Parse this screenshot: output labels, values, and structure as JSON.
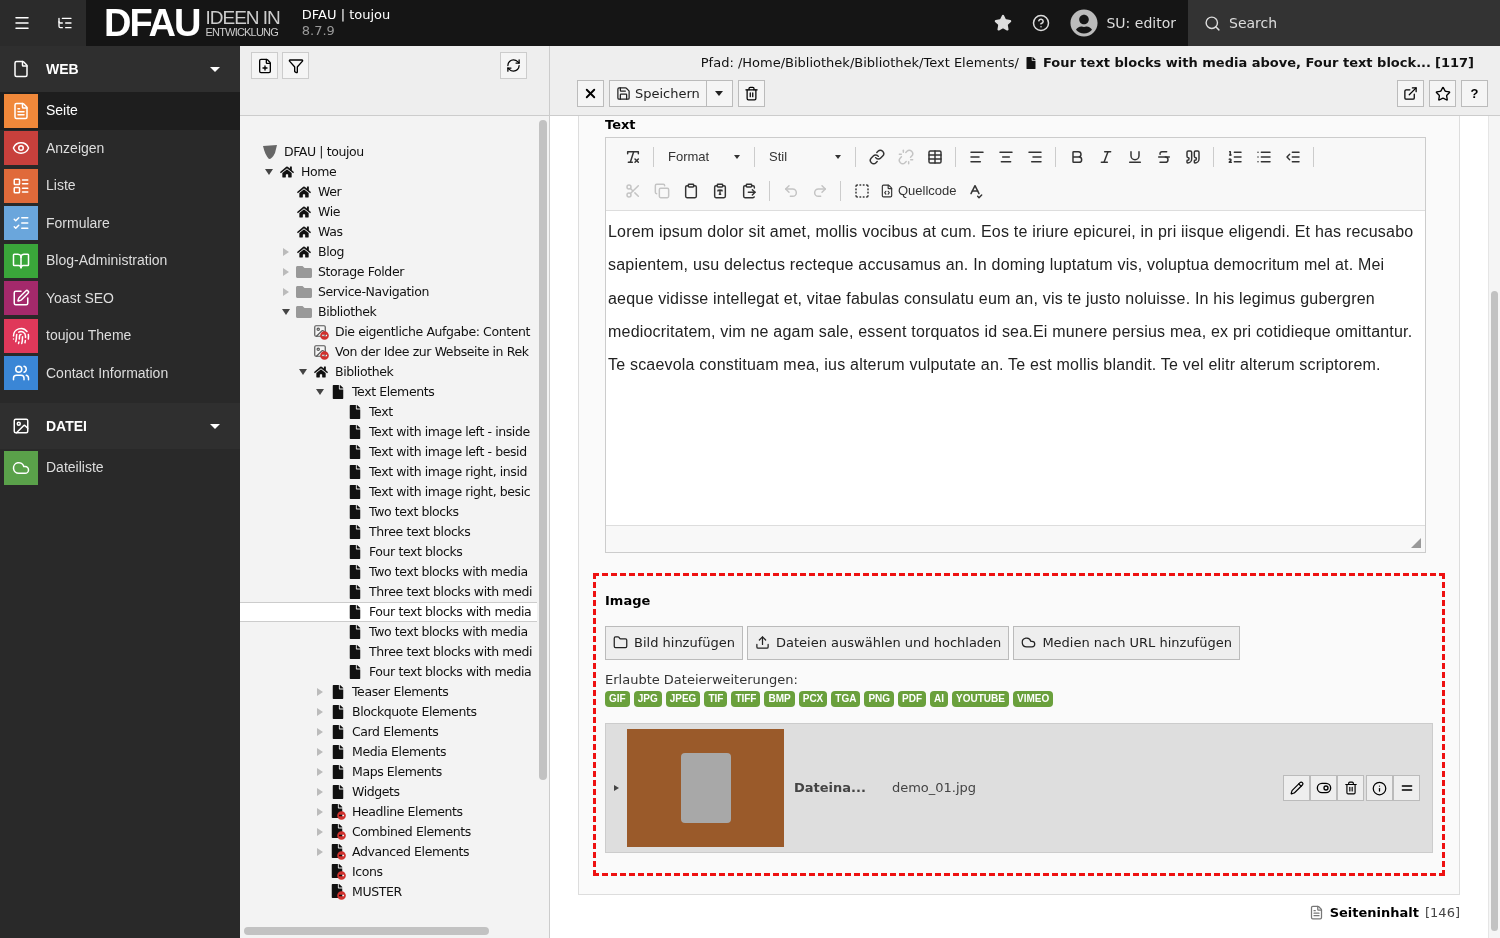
{
  "topbar": {
    "logo_main": "DFAU",
    "logo_line1": "IDEEN IN",
    "logo_line2": "ENTWICKLUNG",
    "site_name": "DFAU | toujou",
    "version": "8.7.9",
    "user": "SU: editor",
    "search": "Search"
  },
  "modules": [
    {
      "label": "WEB",
      "expanded": true,
      "items": [
        {
          "label": "Seite",
          "kind": "page",
          "color": "#f0883a",
          "selected": true
        },
        {
          "label": "Anzeigen",
          "kind": "view",
          "color": "#c8403c",
          "selected": false
        },
        {
          "label": "Liste",
          "kind": "list",
          "color": "#e06a3a",
          "selected": false
        },
        {
          "label": "Formulare",
          "kind": "form",
          "color": "#6aa6dc",
          "selected": false
        },
        {
          "label": "Blog-Administration",
          "kind": "blog",
          "color": "#3aa63a",
          "selected": false
        },
        {
          "label": "Yoast SEO",
          "kind": "seo",
          "color": "#a4296b",
          "selected": false
        },
        {
          "label": "toujou Theme",
          "kind": "theme",
          "color": "#e0385a",
          "selected": false
        },
        {
          "label": "Contact Information",
          "kind": "contact",
          "color": "#3a86d6",
          "selected": false
        }
      ]
    },
    {
      "label": "DATEI",
      "expanded": true,
      "items": [
        {
          "label": "Dateiliste",
          "kind": "files",
          "color": "#5aa14a",
          "selected": false
        }
      ]
    }
  ],
  "tree": {
    "nodes": [
      {
        "label": "DFAU | toujou",
        "kind": "site",
        "selected": false,
        "children": [
          {
            "label": "Home",
            "kind": "home",
            "expanded": true,
            "selected": false,
            "children": [
              {
                "label": "Wer",
                "kind": "home",
                "selected": false
              },
              {
                "label": "Wie",
                "kind": "home",
                "selected": false
              },
              {
                "label": "Was",
                "kind": "home",
                "selected": false
              },
              {
                "label": "Blog",
                "kind": "home",
                "expanded": false,
                "selected": false
              },
              {
                "label": "Storage Folder",
                "kind": "folder",
                "expanded": false,
                "selected": false
              },
              {
                "label": "Service-Navigation",
                "kind": "folder",
                "expanded": false,
                "selected": false
              },
              {
                "label": "Bibliothek",
                "kind": "folder",
                "expanded": true,
                "selected": false,
                "children": [
                  {
                    "label": "Die eigentliche Aufgabe: Content",
                    "kind": "restricted_content",
                    "selected": false
                  },
                  {
                    "label": "Von der Idee zur Webseite in Rek",
                    "kind": "restricted_content",
                    "selected": false
                  },
                  {
                    "label": "Bibliothek",
                    "kind": "home",
                    "expanded": true,
                    "selected": false,
                    "children": [
                      {
                        "label": "Text Elements",
                        "kind": "page",
                        "expanded": true,
                        "selected": false,
                        "children": [
                          {
                            "label": "Text",
                            "kind": "page",
                            "selected": false
                          },
                          {
                            "label": "Text with image left - inside",
                            "kind": "page",
                            "selected": false
                          },
                          {
                            "label": "Text with image left - besid",
                            "kind": "page",
                            "selected": false
                          },
                          {
                            "label": "Text with image right, insid",
                            "kind": "page",
                            "selected": false
                          },
                          {
                            "label": "Text with image right, besic",
                            "kind": "page",
                            "selected": false
                          },
                          {
                            "label": "Two text blocks",
                            "kind": "page",
                            "selected": false
                          },
                          {
                            "label": "Three text blocks",
                            "kind": "page",
                            "selected": false
                          },
                          {
                            "label": "Four text blocks",
                            "kind": "page",
                            "selected": false
                          },
                          {
                            "label": "Two text blocks with media",
                            "kind": "page",
                            "selected": false
                          },
                          {
                            "label": "Three text blocks with medi",
                            "kind": "page",
                            "selected": false
                          },
                          {
                            "label": "Four text blocks with media",
                            "kind": "page",
                            "selected": true
                          },
                          {
                            "label": "Two text blocks with media",
                            "kind": "page",
                            "selected": false
                          },
                          {
                            "label": "Three text blocks with medi",
                            "kind": "page",
                            "selected": false
                          },
                          {
                            "label": "Four text blocks with media",
                            "kind": "page",
                            "selected": false
                          }
                        ]
                      },
                      {
                        "label": "Teaser Elements",
                        "kind": "page",
                        "expanded": false,
                        "selected": false
                      },
                      {
                        "label": "Blockquote Elements",
                        "kind": "page",
                        "expanded": false,
                        "selected": false
                      },
                      {
                        "label": "Card Elements",
                        "kind": "page",
                        "expanded": false,
                        "selected": false
                      },
                      {
                        "label": "Media Elements",
                        "kind": "page",
                        "expanded": false,
                        "selected": false
                      },
                      {
                        "label": "Maps Elements",
                        "kind": "page",
                        "expanded": false,
                        "selected": false
                      },
                      {
                        "label": "Widgets",
                        "kind": "page",
                        "expanded": false,
                        "selected": false
                      },
                      {
                        "label": "Headline Elements",
                        "kind": "hidden_page",
                        "expanded": false,
                        "selected": false
                      },
                      {
                        "label": "Combined Elements",
                        "kind": "hidden_page",
                        "expanded": false,
                        "selected": false
                      },
                      {
                        "label": "Advanced Elements",
                        "kind": "hidden_page",
                        "expanded": false,
                        "selected": false
                      },
                      {
                        "label": "Icons",
                        "kind": "hidden_page",
                        "selected": false
                      },
                      {
                        "label": "MUSTER",
                        "kind": "hidden_page",
                        "selected": false
                      }
                    ]
                  }
                ]
              }
            ]
          }
        ]
      }
    ]
  },
  "docheader": {
    "path_prefix": "Pfad: /Home/Bibliothek/Bibliothek/Text Elements/",
    "page_title": "Four text blocks with media above, Four text block...",
    "page_uid": "[117]",
    "save_label": "Speichern",
    "help_label": "?"
  },
  "form": {
    "text_label": "Text",
    "editor": {
      "toolbar": [
        [
          {
            "kind": "removeformat",
            "disabled": false
          },
          {
            "kind": "separator"
          },
          {
            "kind": "dropdown",
            "label": "Format"
          },
          {
            "kind": "separator"
          },
          {
            "kind": "dropdown",
            "label": "Stil"
          },
          {
            "kind": "separator"
          },
          {
            "kind": "link",
            "disabled": false
          },
          {
            "kind": "unlink",
            "disabled": true
          },
          {
            "kind": "table",
            "disabled": false
          },
          {
            "kind": "separator"
          },
          {
            "kind": "alignleft",
            "disabled": false
          },
          {
            "kind": "aligncenter",
            "disabled": false
          },
          {
            "kind": "alignright",
            "disabled": false
          },
          {
            "kind": "separator"
          },
          {
            "kind": "bold",
            "disabled": false
          },
          {
            "kind": "italic",
            "disabled": false
          },
          {
            "kind": "underline",
            "disabled": false
          },
          {
            "kind": "strike",
            "disabled": false
          },
          {
            "kind": "blockquote",
            "disabled": false
          },
          {
            "kind": "separator"
          },
          {
            "kind": "orderedlist",
            "disabled": false
          },
          {
            "kind": "bulletlist",
            "disabled": false
          },
          {
            "kind": "indent",
            "disabled": false
          },
          {
            "kind": "separator"
          }
        ],
        [
          {
            "kind": "cut",
            "disabled": true
          },
          {
            "kind": "copy",
            "disabled": true
          },
          {
            "kind": "paste",
            "disabled": false
          },
          {
            "kind": "pastetext",
            "disabled": false
          },
          {
            "kind": "pasteword",
            "disabled": false
          },
          {
            "kind": "separator"
          },
          {
            "kind": "undo",
            "disabled": true
          },
          {
            "kind": "redo",
            "disabled": true
          },
          {
            "kind": "separator"
          },
          {
            "kind": "showblocks",
            "disabled": false
          },
          {
            "kind": "source",
            "label": "Quellcode",
            "disabled": false
          },
          {
            "kind": "spellcheck",
            "disabled": false
          }
        ]
      ],
      "body": "Lorem ipsum dolor sit amet, mollis vocibus at cum. Eos te iriure epicurei, in pri iisque eligendi. Et has recusabo sapientem, usu delectus recteque accusamus an. In doming luptatum vis, voluptua democritum mel at. Mei aeque vidisse intellegat et, vitae fabulas consulatu eum an, vis te justo noluisse. In his legimus gubergren mediocritatem, vim ne agam sale, essent torquatos id sea.Ei munere persius mea, ex pri cotidieque omittantur. Te scaevola constituam mea, ius alterum vulputate an. Te est mollis blandit. Te vel elitr alterum scriptorem."
    },
    "image": {
      "label": "Image",
      "buttons": [
        {
          "kind": "folder",
          "label": "Bild hinzufügen"
        },
        {
          "kind": "upload",
          "label": "Dateien auswählen und hochladen"
        },
        {
          "kind": "cloud",
          "label": "Medien nach URL hinzufügen"
        }
      ],
      "allowed_label": "Erlaubte Dateierweiterungen:",
      "extensions": [
        "GIF",
        "JPG",
        "JPEG",
        "TIF",
        "TIFF",
        "BMP",
        "PCX",
        "TGA",
        "PNG",
        "PDF",
        "AI",
        "YOUTUBE",
        "VIMEO"
      ],
      "files": [
        {
          "expanded": false,
          "name_label": "Dateina...",
          "filename": "demo_01.jpg"
        }
      ]
    }
  },
  "footer": {
    "record_type": "Seiteninhalt",
    "record_uid": "[146]"
  }
}
